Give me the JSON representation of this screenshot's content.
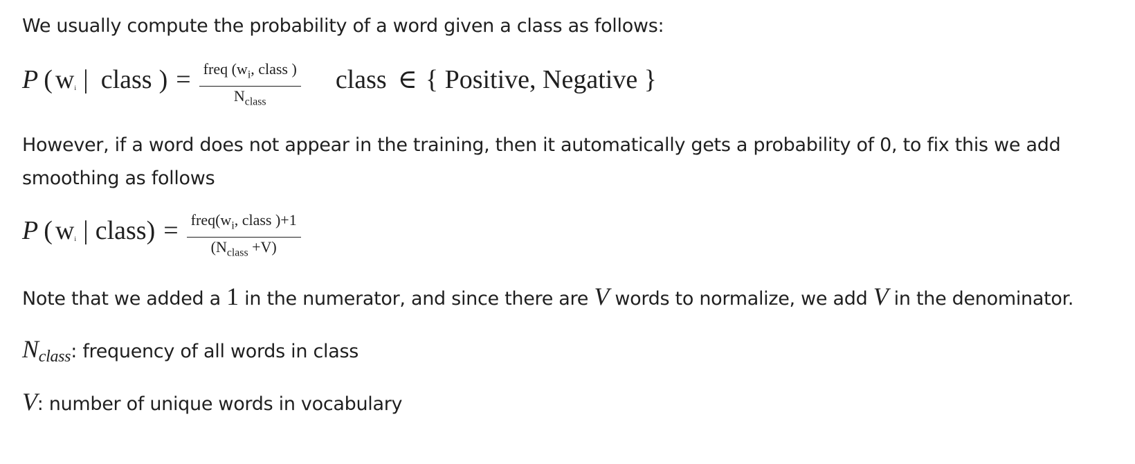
{
  "intro_text": "We usually compute the probability of a word given a class as follows:",
  "eq1": {
    "P": "P",
    "lparen": "(",
    "w": "w",
    "w_sub": "i",
    "bar": "|",
    "class_word": "class",
    "rparen": ")",
    "equals": "=",
    "numerator_pre": "freq (w",
    "numerator_sub": "i",
    "numerator_post": ", class )",
    "denominator_main": "N",
    "denominator_sub": "class",
    "set_class": "class",
    "set_in": "∈",
    "set_body": "{ Positive, Negative }"
  },
  "however_text": "However, if a word does not appear in the training, then it automatically gets a probability of 0, to fix this we add smoothing as follows",
  "eq2": {
    "P": "P",
    "lparen": "(",
    "w": "w",
    "w_sub": "i",
    "bar": "|",
    "class_word": "class)",
    "equals": "=",
    "numerator_pre": "freq(w",
    "numerator_sub": "i",
    "numerator_post": ", class )+1",
    "denominator_pre": "(N",
    "denominator_sub": "class",
    "denominator_post": " +V)"
  },
  "note": {
    "part1": "Note that we added a ",
    "one": "1",
    "part2": " in the numerator, and since there are ",
    "v1": "V",
    "part3": " words to normalize, we add ",
    "v2": "V",
    "part4": " in the denominator."
  },
  "def_n": {
    "symbol": "N",
    "symbol_sub": "class",
    "text": ": frequency of all words in class"
  },
  "def_v": {
    "symbol": "V",
    "text": ": number of unique words in vocabulary"
  }
}
